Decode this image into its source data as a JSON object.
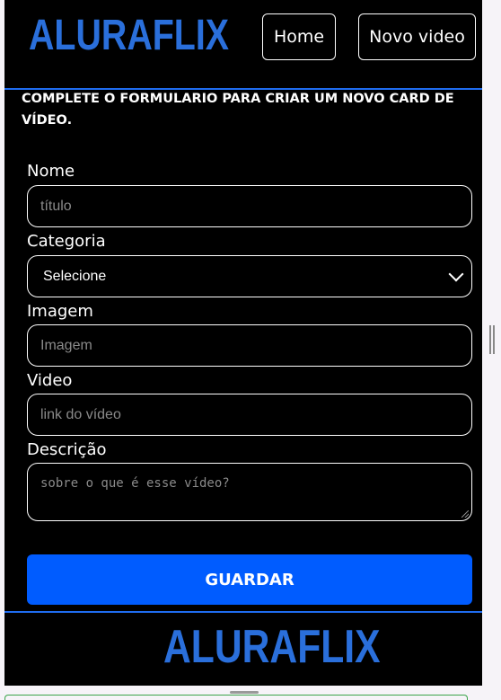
{
  "header": {
    "logo": "ALURAFLIX",
    "nav": {
      "home": "Home",
      "new_video": "Novo video"
    }
  },
  "form": {
    "title": "COMPLETE O FORMULARIO PARA CRIAR UM NOVO CARD DE VÍDEO.",
    "name": {
      "label": "Nome",
      "placeholder": "título"
    },
    "category": {
      "label": "Categoria",
      "selected": "Selecione"
    },
    "image": {
      "label": "Imagem",
      "placeholder": "Imagem"
    },
    "video": {
      "label": "Video",
      "placeholder": "link do vídeo"
    },
    "description": {
      "label": "Descrição",
      "placeholder": "sobre o que é esse vídeo?"
    },
    "submit": "GUARDAR"
  },
  "footer": {
    "logo": "ALURAFLIX"
  },
  "colors": {
    "accent": "#2a6fdb",
    "button": "#005cff",
    "background": "#000000"
  }
}
